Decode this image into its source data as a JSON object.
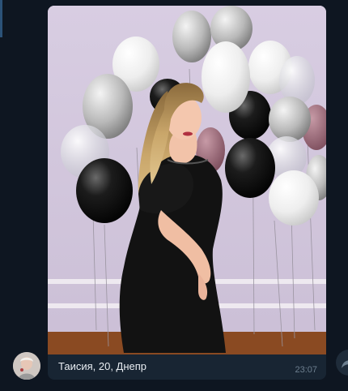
{
  "message": {
    "caption": "Таисия, 20, Днепр",
    "time": "23:07"
  },
  "photo": {
    "subject": "photo-woman-with-balloons"
  },
  "sender": {
    "avatar": "avatar-icon"
  },
  "actions": {
    "forward_icon": "forward-icon"
  },
  "colors": {
    "background": "#0e1621",
    "bubble": "#182533",
    "caption_text": "#e9eef3",
    "timestamp": "#6d7f8f"
  }
}
